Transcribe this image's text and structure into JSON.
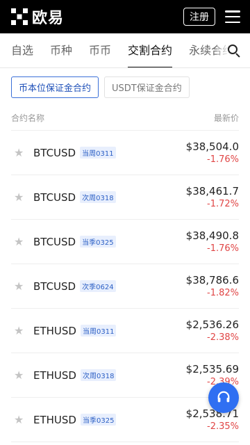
{
  "header": {
    "logo_text": "欧易",
    "register_label": "注册"
  },
  "tabs": [
    {
      "label": "自选",
      "active": false
    },
    {
      "label": "币种",
      "active": false
    },
    {
      "label": "币币",
      "active": false
    },
    {
      "label": "交割合约",
      "active": true
    },
    {
      "label": "永续合约",
      "active": false
    }
  ],
  "filters": [
    {
      "label": "币本位保证金合约",
      "active": true
    },
    {
      "label": "USDT保证金合约",
      "active": false
    }
  ],
  "list_head": {
    "left": "合约名称",
    "right": "最新价"
  },
  "rows": [
    {
      "symbol": "BTCUSD",
      "tag": "当周0311",
      "price": "$38,504.0",
      "change": "-1.76%"
    },
    {
      "symbol": "BTCUSD",
      "tag": "次周0318",
      "price": "$38,461.7",
      "change": "-1.72%"
    },
    {
      "symbol": "BTCUSD",
      "tag": "当季0325",
      "price": "$38,490.8",
      "change": "-1.76%"
    },
    {
      "symbol": "BTCUSD",
      "tag": "次季0624",
      "price": "$38,786.6",
      "change": "-1.82%"
    },
    {
      "symbol": "ETHUSD",
      "tag": "当周0311",
      "price": "$2,536.26",
      "change": "-2.38%"
    },
    {
      "symbol": "ETHUSD",
      "tag": "次周0318",
      "price": "$2,535.69",
      "change": "-2.39%"
    },
    {
      "symbol": "ETHUSD",
      "tag": "当季0325",
      "price": "$2,538.71",
      "change": "-2.35%"
    }
  ],
  "icons": {
    "logo": "okx-logo-icon",
    "menu": "menu-icon",
    "search": "search-icon",
    "star": "star-icon",
    "support": "headset-icon"
  },
  "colors": {
    "topbar_bg": "#000000",
    "negative": "#e04545",
    "accent": "#2f6ff2",
    "tag_bg": "#e8effd",
    "tag_text": "#2b5fc5"
  }
}
